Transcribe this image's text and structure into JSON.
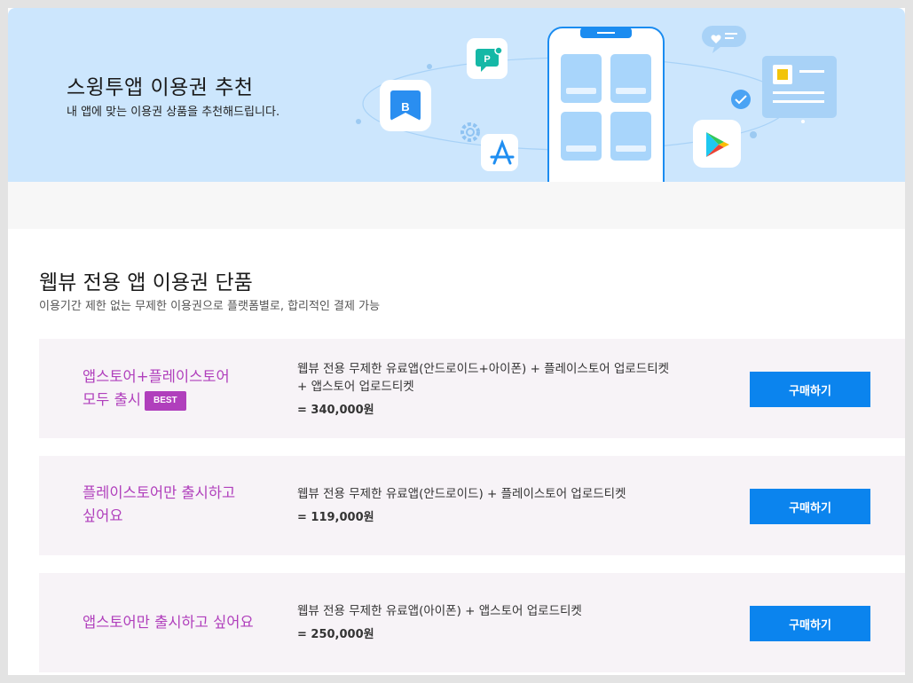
{
  "banner": {
    "title": "스윙투앱 이용권 추천",
    "subtitle": "내 앱에 맞는 이용권 상품을 추천해드립니다.",
    "icon_labels": {
      "b_icon": "B",
      "p_icon": "P"
    }
  },
  "section": {
    "title": "웹뷰 전용 앱 이용권 단품",
    "subtitle": "이용기간 제한 없는 무제한 이용권으로 플랫폼별로, 합리적인 결제 가능"
  },
  "plans": [
    {
      "name_line1": "앱스토어+플레이스토어",
      "name_line2": "모두 출시",
      "badge": "BEST",
      "desc_line1": "웹뷰 전용 무제한 유료앱(안드로이드+아이폰) + 플레이스토어 업로드티켓",
      "desc_line2": "+ 앱스토어 업로드티켓",
      "price": "= 340,000원",
      "button": "구매하기"
    },
    {
      "name_line1": "플레이스토어만 출시하고",
      "name_line2": "싶어요",
      "desc_line1": "웹뷰 전용 무제한 유료앱(안드로이드) + 플레이스토어 업로드티켓",
      "price": "= 119,000원",
      "button": "구매하기"
    },
    {
      "name_line1": "앱스토어만 출시하고 싶어요",
      "desc_line1": "웹뷰 전용 무제한 유료앱(아이폰) + 앱스토어 업로드티켓",
      "price": "= 250,000원",
      "button": "구매하기"
    }
  ],
  "colors": {
    "banner_bg": "#cce6fd",
    "accent_purple": "#b03fbc",
    "button_blue": "#0b84ee",
    "card_bg": "#f7f3f7"
  },
  "icons": [
    "b-app-icon",
    "p-chat-icon",
    "gear-icon",
    "app-store-icon",
    "phone-illustration",
    "heart-bubble-icon",
    "checkmark-icon",
    "document-card-icon",
    "google-play-icon"
  ]
}
